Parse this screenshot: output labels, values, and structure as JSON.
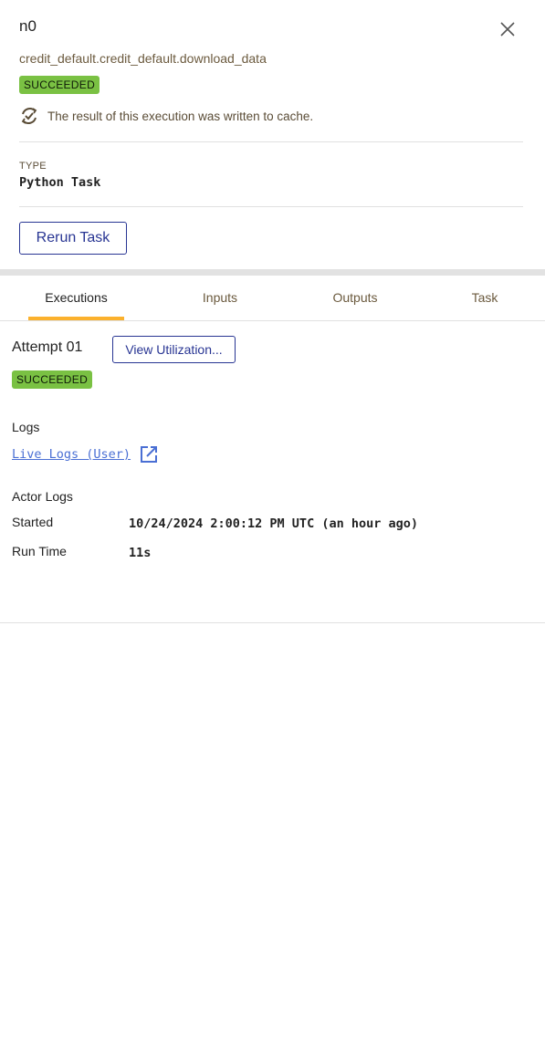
{
  "header": {
    "title": "n0",
    "task_name": "credit_default.credit_default.download_data",
    "status": "SUCCEEDED",
    "status_color": "#7ac143",
    "cache_message": "The result of this execution was written to cache.",
    "type_label": "TYPE",
    "type_value": "Python Task",
    "rerun_label": "Rerun Task"
  },
  "tabs": [
    {
      "label": "Executions",
      "active": true
    },
    {
      "label": "Inputs"
    },
    {
      "label": "Outputs"
    },
    {
      "label": "Task"
    }
  ],
  "execution": {
    "attempt_label": "Attempt 01",
    "view_utilization_label": "View Utilization...",
    "status": "SUCCEEDED",
    "logs_label": "Logs",
    "live_logs_link": "Live Logs (User)",
    "actor_logs_label": "Actor Logs",
    "started_label": "Started",
    "started_value": "10/24/2024 2:00:12 PM UTC (an hour ago)",
    "runtime_label": "Run Time",
    "runtime_value": "11s"
  },
  "colors": {
    "accent": "#fbb12d",
    "button": "#283593",
    "link": "#4a6fd4"
  }
}
